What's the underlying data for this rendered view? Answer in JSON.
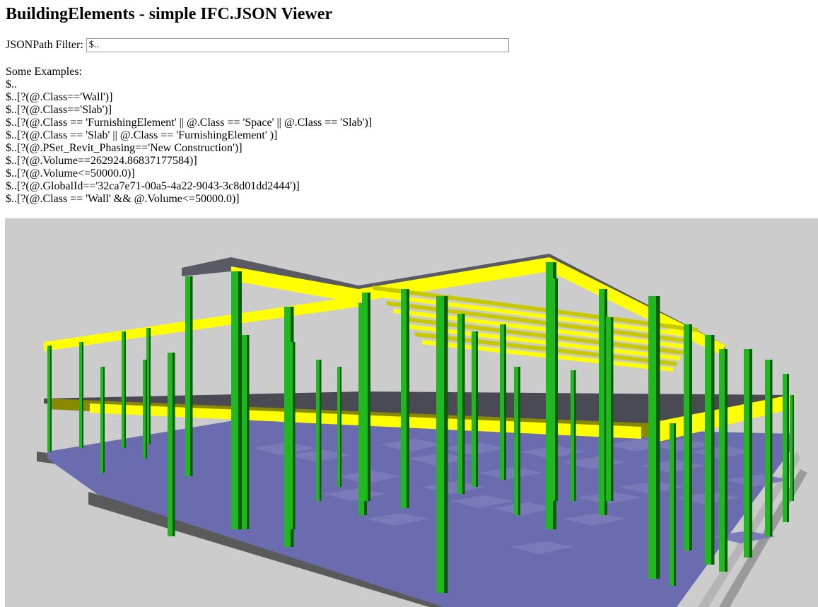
{
  "page": {
    "title": "BuildingElements - simple IFC.JSON Viewer"
  },
  "filter": {
    "label": "JSONPath Filter:",
    "value": "$.."
  },
  "examples": {
    "heading": "Some Examples:",
    "items": [
      "$..",
      "$..[?(@.Class=='Wall')]",
      "$..[?(@.Class=='Slab')]",
      "$..[?(@.Class == 'FurnishingElement' || @.Class == 'Space' || @.Class == 'Slab')]",
      "$..[?(@.Class == 'Slab' || @.Class == 'FurnishingElement' )]",
      "$..[?(@.PSet_Revit_Phasing=='New Construction')]",
      "$..[?(@.Volume==262924.86837177584)]",
      "$..[?(@.Volume<=50000.0)]",
      "$..[?(@.GlobalId=='32ca7e71-00a5-4a22-9043-3c8d01dd2444')]",
      "$..[?(@.Class == 'Wall' && @.Volume<=50000.0)]"
    ]
  },
  "viewer": {
    "background": "#cccccc",
    "colors": {
      "slab": "#6b6bb0",
      "footing": "#7a7ab8",
      "beam": "#ffff00",
      "beam_shade": "#8a8a00",
      "column": "#1fb81f",
      "column_dark": "#0b5a0b",
      "foundation_wall": "#5a5a5a",
      "roof_deck": "#5a5a66"
    }
  }
}
